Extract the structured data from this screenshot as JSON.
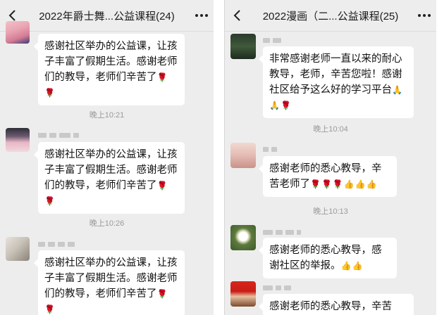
{
  "left_chat": {
    "title": "2022年爵士舞...公益课程(24)",
    "messages": [
      {
        "text": "感谢社区举办的公益课，让孩子丰富了假期生活。感谢老师们的教导，老师们辛苦了",
        "emoji": "🌹🌹"
      },
      {
        "text": "感谢社区举办的公益课，让孩子丰富了假期生活。感谢老师们的教导，老师们辛苦了",
        "emoji": "🌹🌹"
      },
      {
        "text": "感谢社区举办的公益课，让孩子丰富了假期生活。感谢老师们的教导，老师们辛苦了",
        "emoji": "🌹🌹"
      }
    ],
    "times": [
      "晚上10:21",
      "晚上10:26"
    ]
  },
  "right_chat": {
    "title": "2022漫画（二...公益课程(25)",
    "messages": [
      {
        "text": "非常感谢老师一直以来的耐心教导，老师，辛苦您啦！感谢社区给予这么好的学习平台",
        "emoji": "🙏🙏🌹"
      },
      {
        "text": "感谢老师的悉心教导，辛苦老师了",
        "emoji": "🌹🌹🌹👍👍👍"
      },
      {
        "text": "感谢老师的悉心教导，感谢社区的举报。",
        "emoji": "👍👍"
      },
      {
        "text": "感谢老师的悉心教导，辛苦",
        "emoji": ""
      }
    ],
    "times": [
      "晚上10:04",
      "晚上10:13"
    ]
  },
  "icons": {
    "back": "back-arrow-icon",
    "more": "more-options-icon"
  },
  "colors": {
    "chat_bg": "#ededed",
    "bubble": "#ffffff",
    "time_text": "#9a9a9a"
  }
}
